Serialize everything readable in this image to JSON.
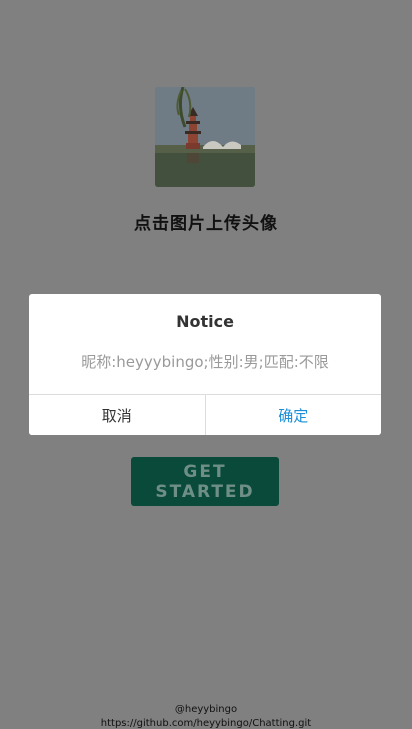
{
  "avatar": {
    "alt": "pagoda by the lake"
  },
  "upload": {
    "label": "点击图片上传头像"
  },
  "start": {
    "label": "GET STARTED"
  },
  "footer": {
    "author": "@heyybingo",
    "link": "https://github.com/heyybingo/Chatting.git"
  },
  "modal": {
    "title": "Notice",
    "message": "昵称:heyyybingo;性别:男;匹配:不限",
    "cancel_label": "取消",
    "confirm_label": "确定"
  },
  "colors": {
    "overlay": "#808080",
    "button_bg": "#0a4a3b",
    "confirm_text": "#1a8fd8"
  }
}
